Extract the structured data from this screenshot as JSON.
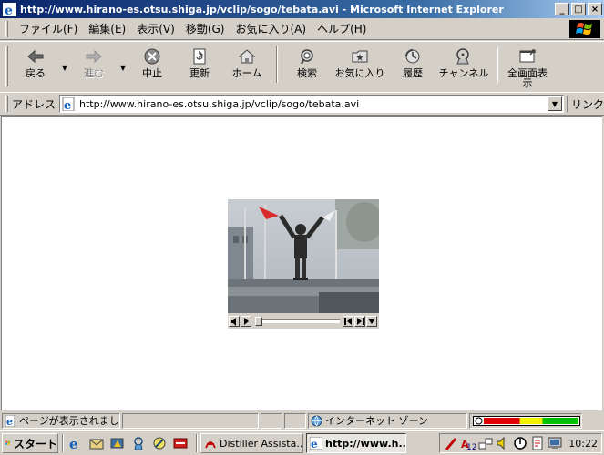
{
  "window": {
    "title": "http://www.hirano-es.otsu.shiga.jp/vclip/sogo/tebata.avi - Microsoft Internet Explorer",
    "controls": {
      "minimize": "_",
      "maximize": "□",
      "close": "×"
    }
  },
  "menu": {
    "items": [
      "ファイル(F)",
      "編集(E)",
      "表示(V)",
      "移動(G)",
      "お気に入り(A)",
      "ヘルプ(H)"
    ]
  },
  "toolbar": {
    "buttons": [
      {
        "label": "戻る",
        "icon": "back-arrow-icon",
        "enabled": true
      },
      {
        "label": "進む",
        "icon": "forward-arrow-icon",
        "enabled": false
      },
      {
        "label": "中止",
        "icon": "stop-icon",
        "enabled": true
      },
      {
        "label": "更新",
        "icon": "refresh-icon",
        "enabled": true
      },
      {
        "label": "ホーム",
        "icon": "home-icon",
        "enabled": true
      },
      {
        "label": "検索",
        "icon": "search-icon",
        "enabled": true
      },
      {
        "label": "お気に入り",
        "icon": "favorites-icon",
        "enabled": true
      },
      {
        "label": "履歴",
        "icon": "history-icon",
        "enabled": true
      },
      {
        "label": "チャンネル",
        "icon": "channels-icon",
        "enabled": true
      },
      {
        "label": "全画面表示",
        "icon": "fullscreen-icon",
        "enabled": true
      }
    ]
  },
  "address": {
    "label": "アドレス",
    "url": "http://www.hirano-es.otsu.shiga.jp/vclip/sogo/tebata.avi",
    "links_label": "リンク"
  },
  "player": {
    "icon": "video-frame",
    "progress": 0.0
  },
  "status": {
    "message": "ページが表示されまし",
    "zone": "インターネット ゾーン",
    "colors": {
      "red": "#e00000",
      "yellow": "#f0f000",
      "green": "#00c000"
    }
  },
  "taskbar": {
    "start_label": "スタート",
    "tasks": [
      {
        "label": "Distiller Assista...",
        "active": false
      },
      {
        "label": "http://www.h...",
        "active": true
      }
    ],
    "clock": "10:22"
  },
  "colors": {
    "title_start": "#0a246a",
    "title_end": "#a6caf0",
    "chrome": "#d4d0c8"
  }
}
